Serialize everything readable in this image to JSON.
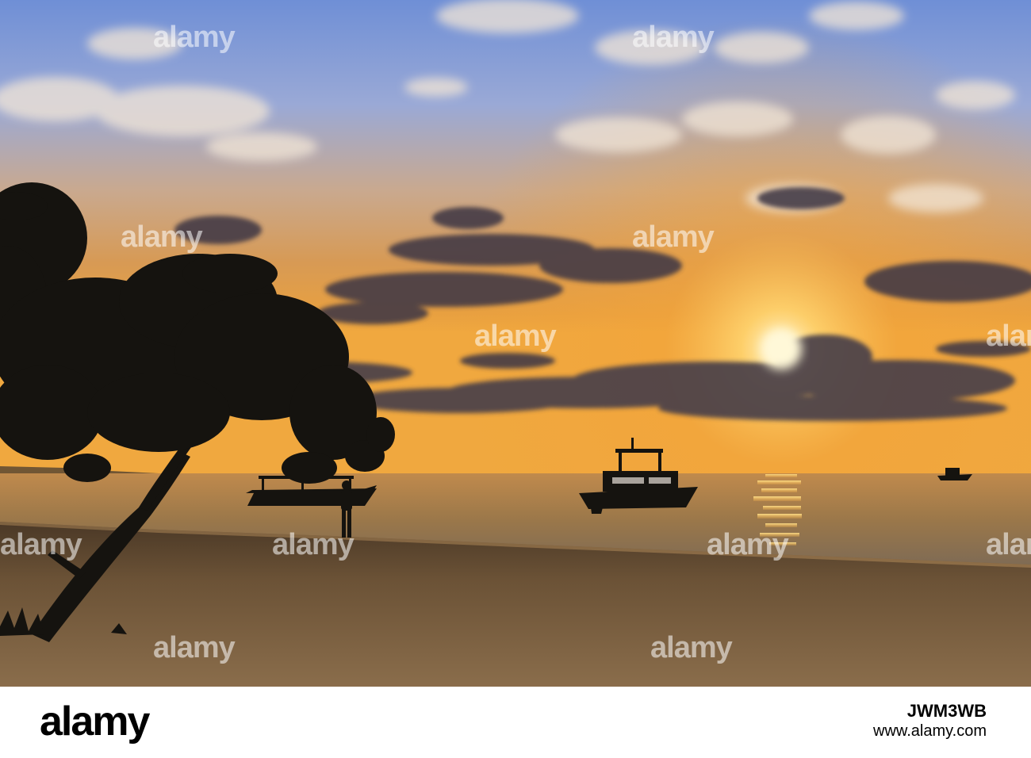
{
  "watermark": {
    "text": "alamy"
  },
  "footer": {
    "logo": "alamy",
    "image_id": "JWM3WB",
    "url": "www.alamy.com"
  },
  "colors": {
    "sky_top": "#6f8fd6",
    "sky_glow": "#f2a33a",
    "sun": "#fff4c8",
    "sea": "#8a6a3c",
    "sand": "#6a5030",
    "silhouette": "#15130f",
    "cloud_dark": "#3f3844"
  }
}
